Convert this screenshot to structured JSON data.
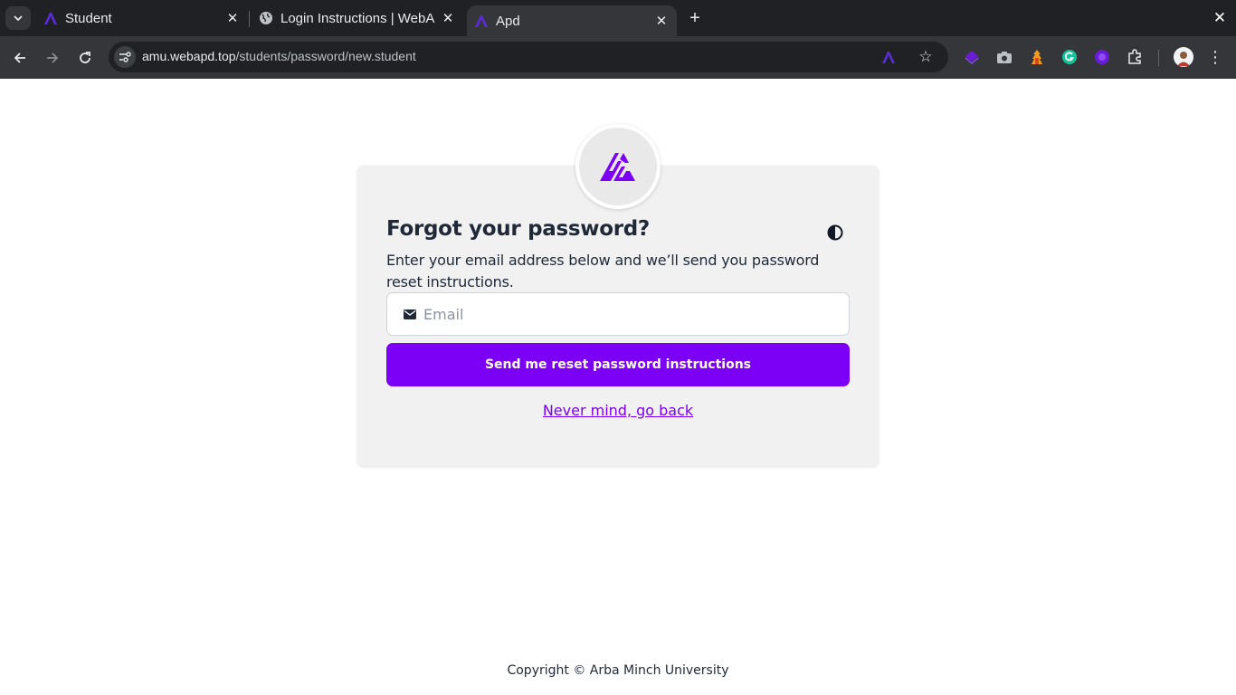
{
  "browser": {
    "tabs": [
      {
        "title": "Student",
        "favicon": "apd-logo-icon",
        "active": false
      },
      {
        "title": "Login Instructions | WebA",
        "favicon": "globe-icon",
        "active": false
      },
      {
        "title": "Apd",
        "favicon": "apd-logo-icon",
        "active": true
      }
    ],
    "url_host": "amu.webapd.top",
    "url_path": "/students/password/new.student"
  },
  "page": {
    "title": "Forgot your password?",
    "description": "Enter your email address below and we’ll send you password reset instructions.",
    "email_placeholder": "Email",
    "email_value": "",
    "submit_label": "Send me reset password instructions",
    "back_link": "Never mind, go back",
    "footer": "Copyright © Arba Minch University"
  },
  "colors": {
    "brand": "#7c00f5",
    "card_bg": "#f1f1f1",
    "chrome_dark": "#202124",
    "chrome_toolbar": "#35363a"
  }
}
